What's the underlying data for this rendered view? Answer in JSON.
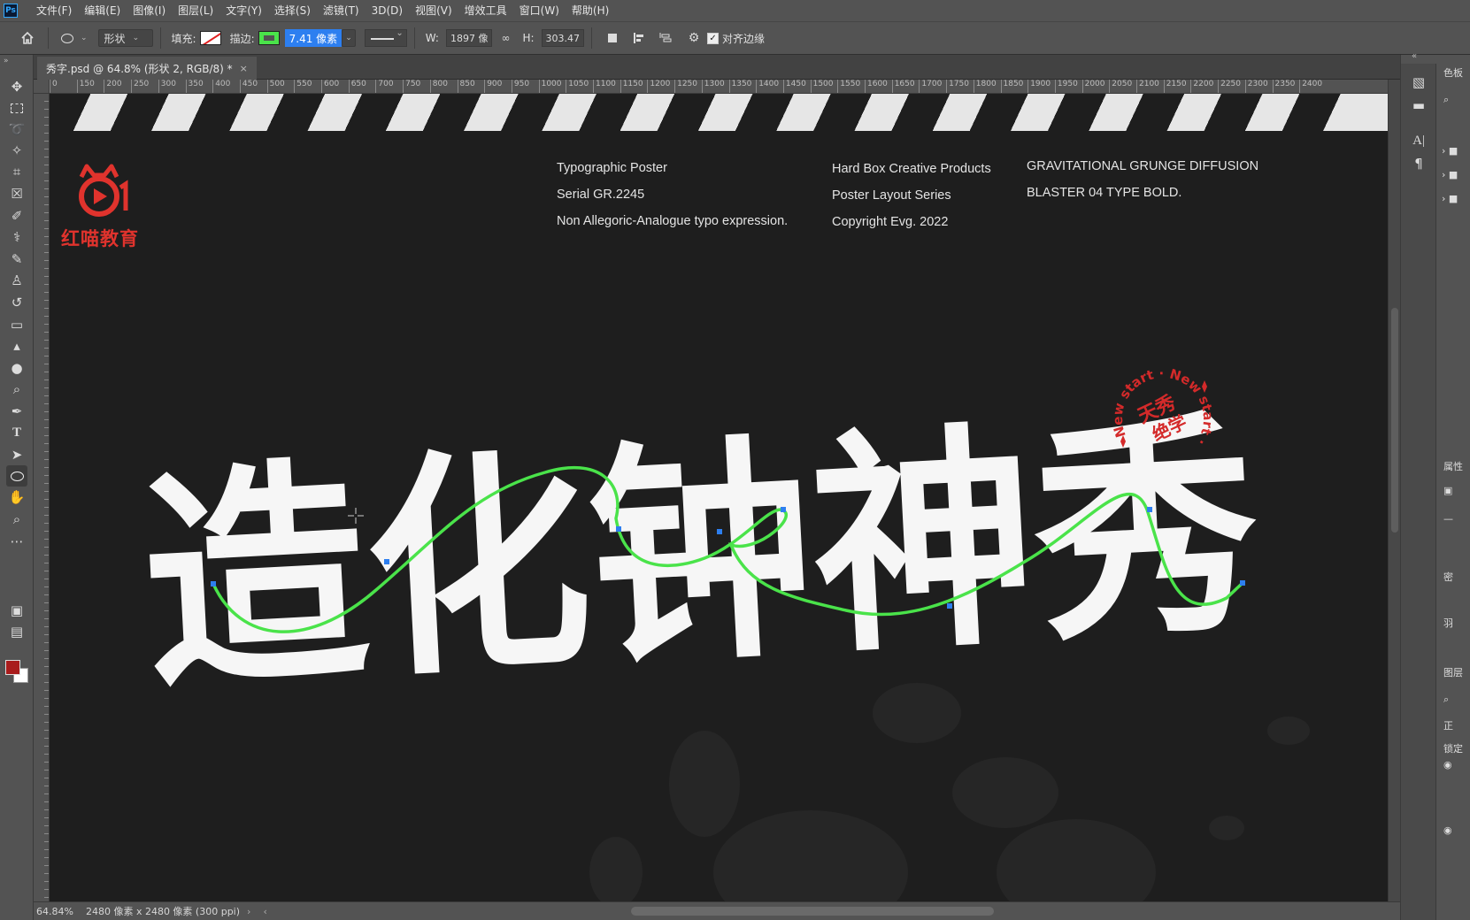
{
  "menubar": {
    "app_icon": "Ps",
    "items": [
      "文件(F)",
      "编辑(E)",
      "图像(I)",
      "图层(L)",
      "文字(Y)",
      "选择(S)",
      "滤镜(T)",
      "3D(D)",
      "视图(V)",
      "增效工具",
      "窗口(W)",
      "帮助(H)"
    ]
  },
  "options": {
    "mode": "形状",
    "fill_label": "填充:",
    "stroke_label": "描边:",
    "stroke_width": "7.41 像素",
    "w_label": "W:",
    "w_value": "1897 像",
    "h_label": "H:",
    "h_value": "303.47",
    "align_edges": "对齐边缘",
    "stroke_color": "#4ae34a",
    "fill_color": "none"
  },
  "document": {
    "tab_title": "秀字.psd @ 64.8% (形状 2, RGB/8) *",
    "tab_close": "×"
  },
  "ruler": {
    "ticks": [
      "0",
      "150",
      "200",
      "250",
      "300",
      "350",
      "400",
      "450",
      "500",
      "550",
      "600",
      "650",
      "700",
      "750",
      "800",
      "850",
      "900",
      "950",
      "1000",
      "1050",
      "1100",
      "1150",
      "1200",
      "1250",
      "1300",
      "1350",
      "1400",
      "1450",
      "1500",
      "1550",
      "1600",
      "1650",
      "1700",
      "1750",
      "1800",
      "1850",
      "1900",
      "1950",
      "2000",
      "2050",
      "2100",
      "2150",
      "2200",
      "2250",
      "2300",
      "2350",
      "2400"
    ]
  },
  "poster": {
    "logo_text": "红喵教育",
    "col1": [
      "Typographic Poster",
      "Serial GR.2245",
      "Non Allegoric-Analogue typo expression."
    ],
    "col2": [
      "Hard Box Creative Products",
      "Poster Layout Series",
      "Copyright Evg. 2022"
    ],
    "col3": [
      "GRAVITATIONAL GRUNGE DIFFUSION",
      "BLASTER 04 TYPE BOLD."
    ],
    "headline": "造化钟神秀",
    "stamp_ring": "New start · New start ·",
    "stamp_center_1": "天秀",
    "stamp_center_2": "绝学",
    "accent_color": "#d42a2a",
    "path_color": "#4ae34a"
  },
  "status": {
    "zoom": "64.84%",
    "doc_info": "2480 像素 x 2480 像素 (300 ppi)"
  },
  "right_panel": {
    "labels": [
      "色板",
      "属性",
      "密",
      "羽",
      "图层",
      "正",
      "锁定"
    ]
  }
}
